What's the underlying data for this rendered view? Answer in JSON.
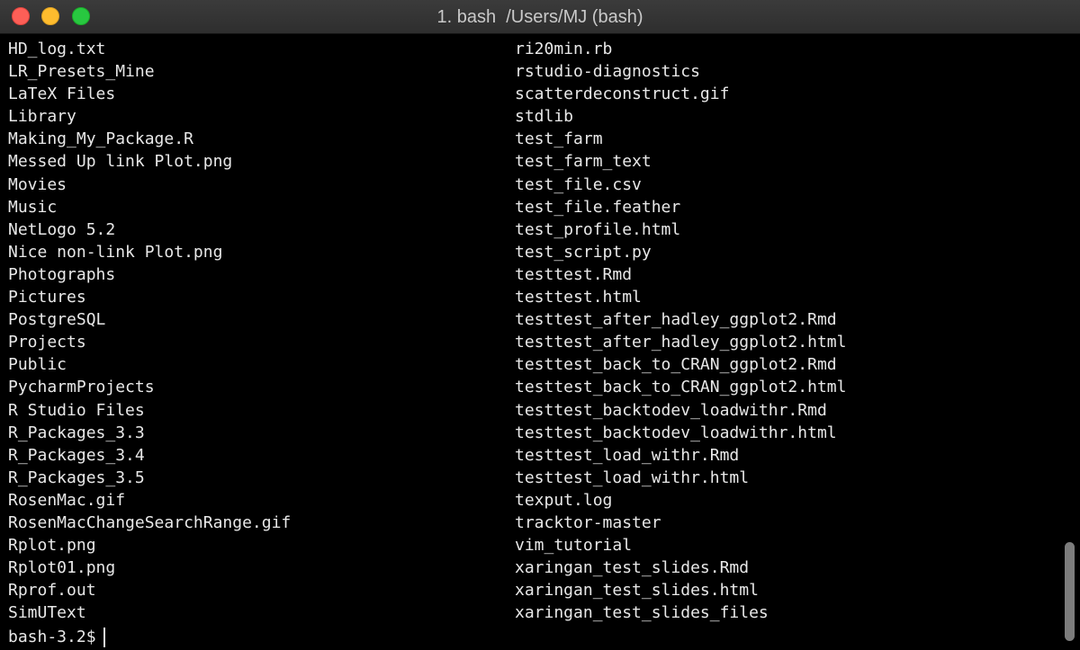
{
  "window": {
    "title": "1. bash  /Users/MJ (bash)",
    "colors": {
      "close": "#fd5f57",
      "minimize": "#febc2e",
      "zoom": "#28c840",
      "background": "#000000",
      "text": "#e8e8e8"
    }
  },
  "listing": {
    "left": [
      "HD_log.txt",
      "LR_Presets_Mine",
      "LaTeX Files",
      "Library",
      "Making_My_Package.R",
      "Messed Up link Plot.png",
      "Movies",
      "Music",
      "NetLogo 5.2",
      "Nice non-link Plot.png",
      "Photographs",
      "Pictures",
      "PostgreSQL",
      "Projects",
      "Public",
      "PycharmProjects",
      "R Studio Files",
      "R_Packages_3.3",
      "R_Packages_3.4",
      "R_Packages_3.5",
      "RosenMac.gif",
      "RosenMacChangeSearchRange.gif",
      "Rplot.png",
      "Rplot01.png",
      "Rprof.out",
      "SimUText"
    ],
    "right": [
      "ri20min.rb",
      "rstudio-diagnostics",
      "scatterdeconstruct.gif",
      "stdlib",
      "test_farm",
      "test_farm_text",
      "test_file.csv",
      "test_file.feather",
      "test_profile.html",
      "test_script.py",
      "testtest.Rmd",
      "testtest.html",
      "testtest_after_hadley_ggplot2.Rmd",
      "testtest_after_hadley_ggplot2.html",
      "testtest_back_to_CRAN_ggplot2.Rmd",
      "testtest_back_to_CRAN_ggplot2.html",
      "testtest_backtodev_loadwithr.Rmd",
      "testtest_backtodev_loadwithr.html",
      "testtest_load_withr.Rmd",
      "testtest_load_withr.html",
      "texput.log",
      "tracktor-master",
      "vim_tutorial",
      "xaringan_test_slides.Rmd",
      "xaringan_test_slides.html",
      "xaringan_test_slides_files"
    ]
  },
  "prompt": {
    "text": "bash-3.2$"
  }
}
